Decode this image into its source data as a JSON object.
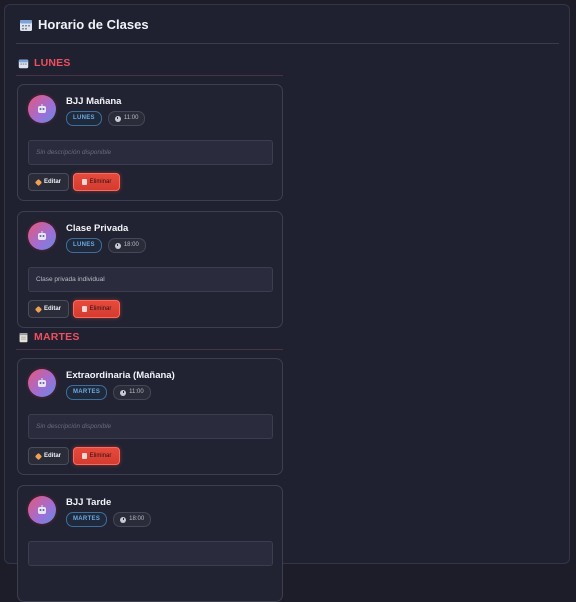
{
  "header": {
    "title": "Horario de Clases",
    "icon": "calendar-icon"
  },
  "days": [
    {
      "label": "LUNES",
      "icon": "calendar-icon",
      "classes": [
        {
          "name": "BJJ Mañana",
          "day_tag": "LUNES",
          "time": "11:00",
          "description": "Sin descripción disponible",
          "has_description": false
        },
        {
          "name": "Clase Privada",
          "day_tag": "LUNES",
          "time": "18:00",
          "description": "Clase privada individual",
          "has_description": true
        }
      ]
    },
    {
      "label": "MARTES",
      "icon": "notepad-icon",
      "classes": [
        {
          "name": "Extraordinaria (Mañana)",
          "day_tag": "MARTES",
          "time": "11:00",
          "description": "Sin descripción disponible",
          "has_description": false
        },
        {
          "name": "BJJ Tarde",
          "day_tag": "MARTES",
          "time": "18:00",
          "description": "",
          "has_description": false
        }
      ]
    }
  ],
  "buttons": {
    "edit": "Editar",
    "delete": "Eliminar"
  },
  "colors": {
    "accent_red": "#ef4f5f",
    "delete_button": "#e64a3d",
    "day_tag": "#6ea8e0",
    "background": "#1c1d29"
  }
}
